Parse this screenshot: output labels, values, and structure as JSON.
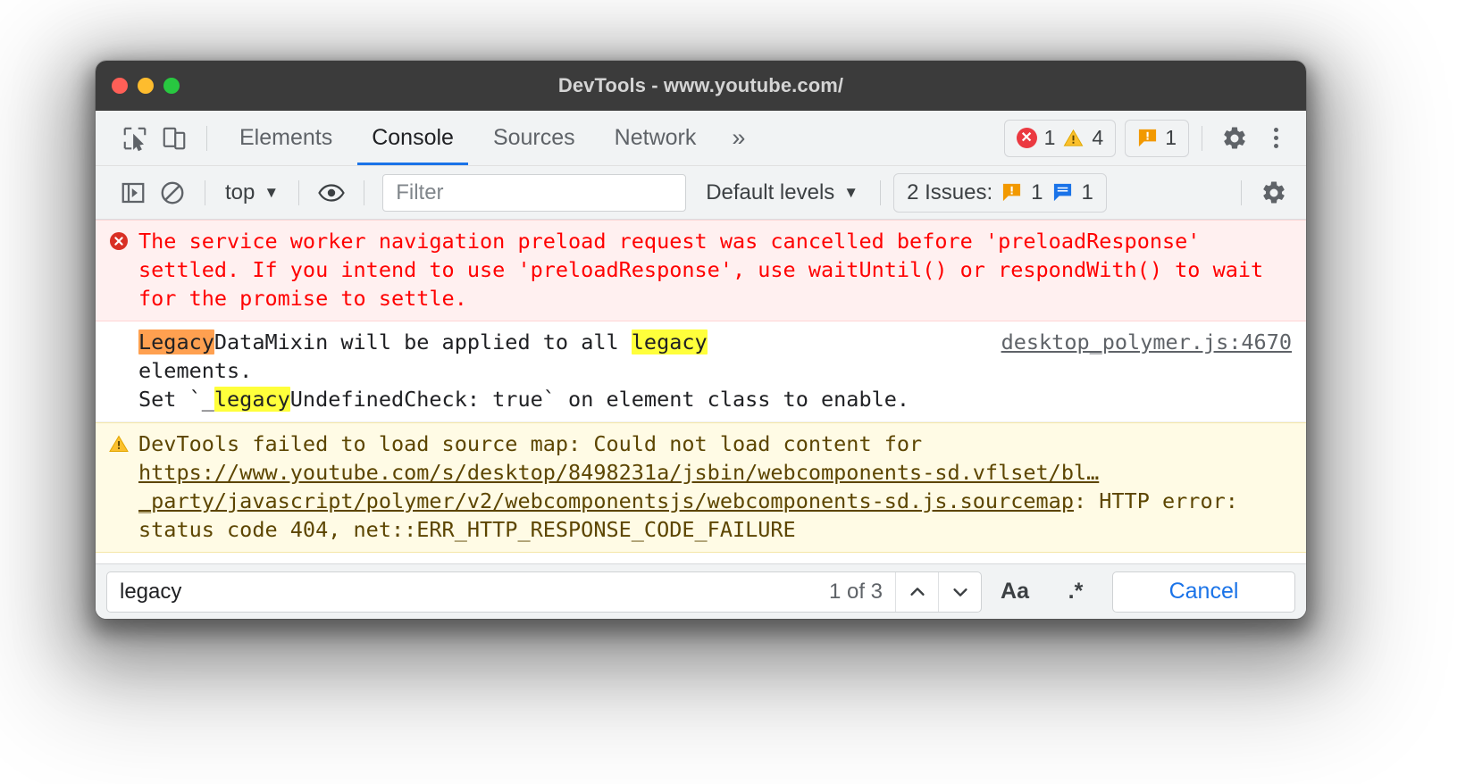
{
  "window": {
    "title": "DevTools - www.youtube.com/",
    "traffic_lights": [
      "close",
      "minimize",
      "zoom"
    ],
    "colors": {
      "close": "#ff5f57",
      "minimize": "#febc2e",
      "zoom": "#28c840",
      "titlebar_bg": "#3b3b3b",
      "accent_blue": "#1a73e8",
      "error_red": "#ff0000",
      "warn_amber": "#5c4500",
      "highlight_yellow": "#ffff3b",
      "highlight_active_orange": "#ffa050"
    }
  },
  "tabbar": {
    "inspect_icon": "inspect-cursor-icon",
    "device_icon": "device-toolbar-icon",
    "tabs": [
      {
        "label": "Elements",
        "active": false
      },
      {
        "label": "Console",
        "active": true
      },
      {
        "label": "Sources",
        "active": false
      },
      {
        "label": "Network",
        "active": false
      }
    ],
    "more_tabs": "»",
    "error_count": "1",
    "warning_count": "4",
    "issue_count": "1",
    "settings_icon": "gear-icon",
    "menu_icon": "kebab-menu-icon"
  },
  "console_toolbar": {
    "sidebar_icon": "console-sidebar-icon",
    "clear_icon": "clear-console-icon",
    "context_label": "top",
    "eye_icon": "live-expression-eye-icon",
    "filter_placeholder": "Filter",
    "filter_value": "",
    "levels_label": "Default levels",
    "issues_label": "2 Issues:",
    "issues_warning_count": "1",
    "issues_info_count": "1",
    "settings_icon": "console-settings-gear-icon"
  },
  "console_messages": [
    {
      "type": "error",
      "icon": "error-circle-icon",
      "text": "The service worker navigation preload request was cancelled before 'preloadResponse' settled. If you intend to use 'preloadResponse', use waitUntil() or respondWith() to wait for the promise to settle.",
      "source_link": ""
    },
    {
      "type": "log",
      "icon": "",
      "text_parts": [
        {
          "text": "Legacy",
          "highlight": "active"
        },
        {
          "text": "DataMixin will be applied to all ",
          "highlight": "none"
        },
        {
          "text": "legacy",
          "highlight": "match"
        },
        {
          "text": "\nelements.\nSet `_",
          "highlight": "none"
        },
        {
          "text": "legacy",
          "highlight": "match"
        },
        {
          "text": "UndefinedCheck: true` on element class to enable.",
          "highlight": "none"
        }
      ],
      "source_link": "desktop_polymer.js:4670"
    },
    {
      "type": "warning",
      "icon": "warning-triangle-icon",
      "prefix": "DevTools failed to load source map: Could not load content for ",
      "url": "https://www.youtube.com/s/desktop/8498231a/jsbin/webcomponents-sd.vflset/bl…_party/javascript/polymer/v2/webcomponentsjs/webcomponents-sd.js.sourcemap",
      "suffix": ": HTTP error: status code 404, net::ERR_HTTP_RESPONSE_CODE_FAILURE",
      "source_link": ""
    }
  ],
  "search_bar": {
    "query": "legacy",
    "match_status": "1 of 3",
    "prev_icon": "chevron-up-icon",
    "next_icon": "chevron-down-icon",
    "match_case_label": "Aa",
    "regex_label": ".*",
    "cancel_label": "Cancel"
  }
}
